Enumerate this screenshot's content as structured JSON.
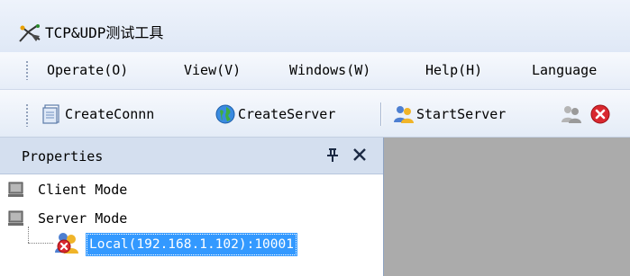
{
  "window": {
    "title": "TCP&UDP测试工具",
    "icon": "scissors-app-icon"
  },
  "menubar": {
    "items": [
      {
        "label": "Operate(O)"
      },
      {
        "label": "View(V)"
      },
      {
        "label": "Windows(W)"
      },
      {
        "label": "Help(H)"
      },
      {
        "label": "Language"
      }
    ]
  },
  "toolbar": {
    "create_conn_label": "CreateConnn",
    "create_server_label": "CreateServer",
    "start_server_label": "StartServer"
  },
  "properties_panel": {
    "title": "Properties",
    "pin_glyph": "ᵽ",
    "close_glyph": "✕",
    "tree": [
      {
        "label": "Client Mode",
        "icon": "computer-icon"
      },
      {
        "label": "Server Mode",
        "icon": "computer-icon"
      },
      {
        "label": "Local(192.168.1.102):10001",
        "icon": "users-stop-icon",
        "selected": true
      }
    ]
  },
  "colors": {
    "selection": "#3399ff",
    "workspace": "#ababab",
    "panel_header": "#d4dfef"
  }
}
